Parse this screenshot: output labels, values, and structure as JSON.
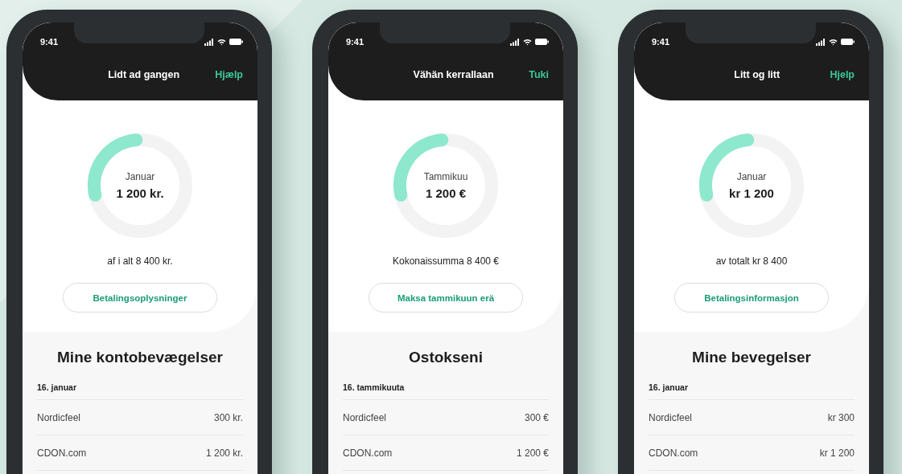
{
  "phones": [
    {
      "status_time": "9:41",
      "nav_title": "Lidt ad gangen",
      "help_link": "Hjælp",
      "month": "Januar",
      "amount": "1 200 kr.",
      "level": 0.27,
      "total": "af i alt 8 400 kr.",
      "button": "Betalingsoplysninger",
      "section_title": "Mine kontobevægelser",
      "date": "16. januar",
      "transactions": [
        {
          "merchant": "Nordicfeel",
          "amount": "300 kr."
        },
        {
          "merchant": "CDON.com",
          "amount": "1 200 kr."
        }
      ]
    },
    {
      "status_time": "9:41",
      "nav_title": "Vähän kerrallaan",
      "help_link": "Tuki",
      "month": "Tammikuu",
      "amount": "1 200 €",
      "level": 0.27,
      "total": "Kokonaissumma 8 400 €",
      "button": "Maksa tammikuun erä",
      "section_title": "Ostokseni",
      "date": "16. tammikuuta",
      "transactions": [
        {
          "merchant": "Nordicfeel",
          "amount": "300 €"
        },
        {
          "merchant": "CDON.com",
          "amount": "1 200 €"
        }
      ]
    },
    {
      "status_time": "9:41",
      "nav_title": "Litt og litt",
      "help_link": "Hjelp",
      "month": "Januar",
      "amount": "kr 1 200",
      "level": 0.27,
      "total": "av totalt kr 8 400",
      "button": "Betalingsinformasjon",
      "section_title": "Mine bevegelser",
      "date": "16. januar",
      "transactions": [
        {
          "merchant": "Nordicfeel",
          "amount": "kr 300"
        },
        {
          "merchant": "CDON.com",
          "amount": "kr 1 200"
        }
      ]
    }
  ]
}
